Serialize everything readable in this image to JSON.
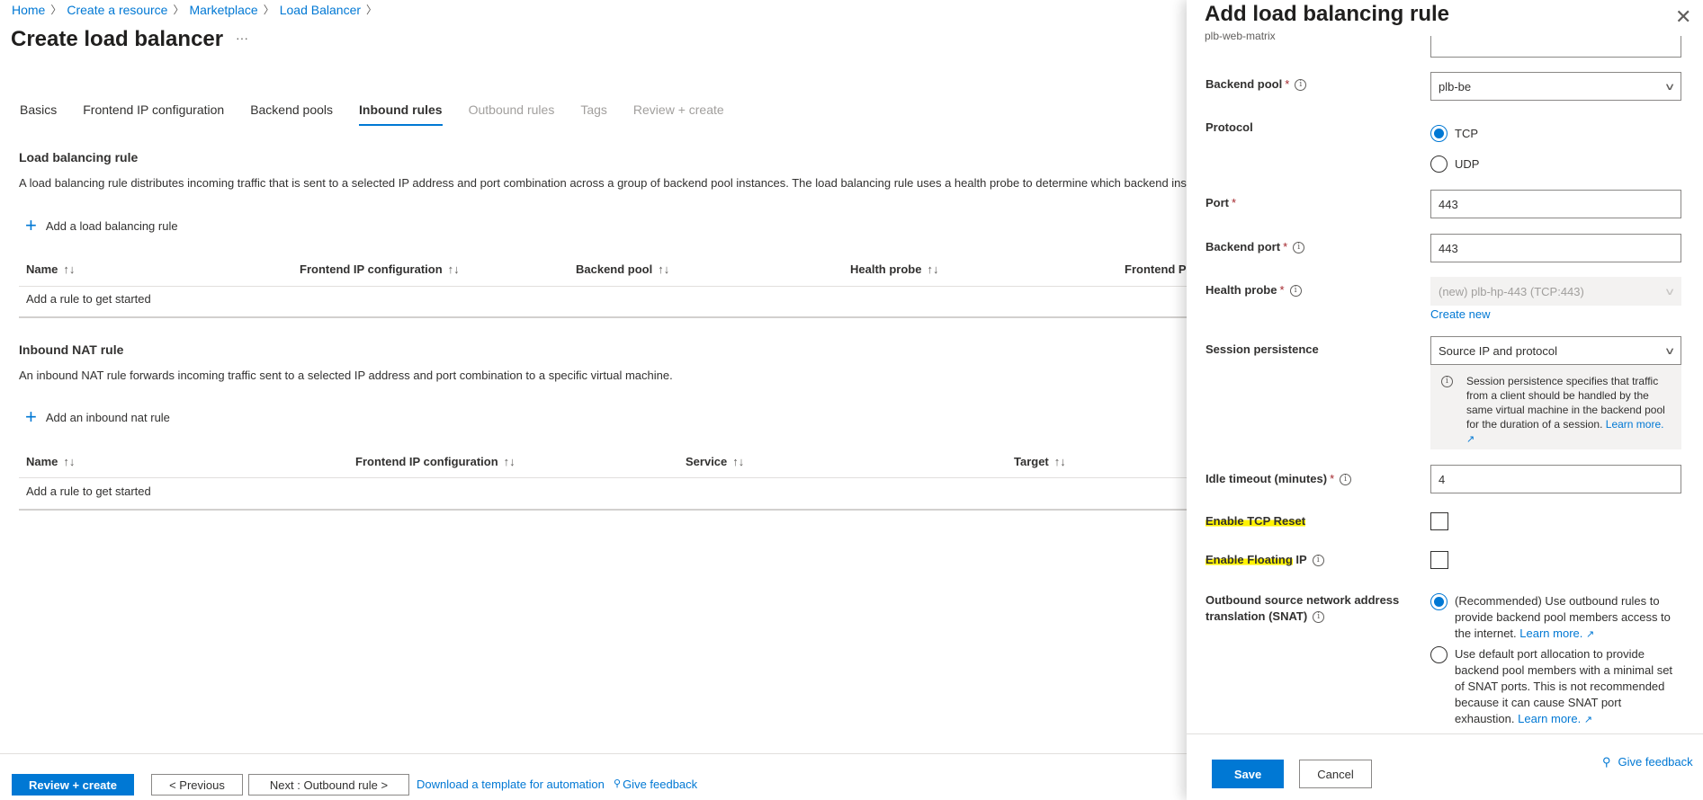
{
  "breadcrumb": [
    "Home",
    "Create a resource",
    "Marketplace",
    "Load Balancer"
  ],
  "page_title": "Create load balancer",
  "more_label": "···",
  "tabs": [
    {
      "label": "Basics",
      "state": "normal"
    },
    {
      "label": "Frontend IP configuration",
      "state": "normal"
    },
    {
      "label": "Backend pools",
      "state": "normal"
    },
    {
      "label": "Inbound rules",
      "state": "active"
    },
    {
      "label": "Outbound rules",
      "state": "disabled"
    },
    {
      "label": "Tags",
      "state": "disabled"
    },
    {
      "label": "Review + create",
      "state": "disabled"
    }
  ],
  "lb_section": {
    "heading": "Load balancing rule",
    "description": "A load balancing rule distributes incoming traffic that is sent to a selected IP address and port combination across a group of backend pool instances. The load balancing rule uses a health probe to determine which backend inst",
    "add_label": "Add a load balancing rule",
    "columns": [
      "Name",
      "Frontend IP configuration",
      "Backend pool",
      "Health probe",
      "Frontend Po"
    ],
    "empty_text": "Add a rule to get started"
  },
  "nat_section": {
    "heading": "Inbound NAT rule",
    "description": "An inbound NAT rule forwards incoming traffic sent to a selected IP address and port combination to a specific virtual machine.",
    "add_label": "Add an inbound nat rule",
    "columns": [
      "Name",
      "Frontend IP configuration",
      "Service",
      "Target"
    ],
    "empty_text": "Add a rule to get started"
  },
  "sort_glyph": "↑↓",
  "footer": {
    "review_create": "Review + create",
    "previous": "< Previous",
    "next": "Next : Outbound rule >",
    "download": "Download a template for automation",
    "feedback": "Give feedback"
  },
  "panel": {
    "title": "Add load balancing rule",
    "subtitle": "plb-web-matrix",
    "backend_pool": {
      "label": "Backend pool",
      "value": "plb-be"
    },
    "protocol": {
      "label": "Protocol",
      "options": [
        "TCP",
        "UDP"
      ],
      "selected": "TCP"
    },
    "port": {
      "label": "Port",
      "value": "443"
    },
    "backend_port": {
      "label": "Backend port",
      "value": "443"
    },
    "health_probe": {
      "label": "Health probe",
      "value": "(new) plb-hp-443 (TCP:443)",
      "create_new": "Create new"
    },
    "session_persistence": {
      "label": "Session persistence",
      "value": "Source IP and protocol",
      "info": "Session persistence specifies that traffic from a client should be handled by the same virtual machine in the backend pool for the duration of a session.",
      "learn_more": "Learn more."
    },
    "idle_timeout": {
      "label": "Idle timeout (minutes)",
      "value": "4"
    },
    "tcp_reset": {
      "label": "Enable TCP Reset",
      "checked": false
    },
    "floating_ip": {
      "label_highlighted": "Enable Floating",
      "label_rest": " IP",
      "checked": false
    },
    "snat": {
      "label": "Outbound source network address translation (SNAT)",
      "option1": "(Recommended) Use outbound rules to provide backend pool members access to the internet.",
      "option2": "Use default port allocation to provide backend pool members with a minimal set of SNAT ports. This is not recommended because it can cause SNAT port exhaustion.",
      "learn_more": "Learn more.",
      "selected": 1
    },
    "save": "Save",
    "cancel": "Cancel",
    "feedback": "Give feedback"
  },
  "colors": {
    "accent": "#0078d4",
    "highlight": "#fff200"
  }
}
